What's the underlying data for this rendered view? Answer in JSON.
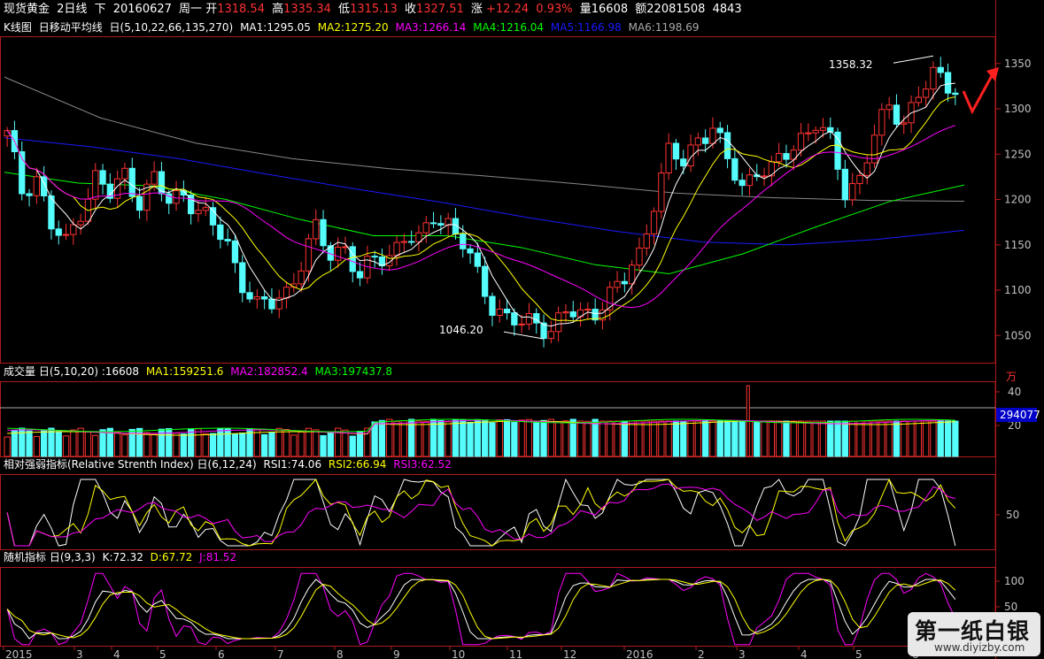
{
  "header": {
    "name": "现货黄金",
    "period": "2日线",
    "arrow": "下",
    "date": "20160627",
    "weekday": "周一",
    "open_label": "开",
    "open": "1318.54",
    "high_label": "高",
    "high": "1335.34",
    "low_label": "低",
    "low": "1315.13",
    "close_label": "收",
    "close": "1327.51",
    "chg_label": "涨",
    "chg": "+12.24",
    "chg_pct": "0.93%",
    "vol_label": "量",
    "vol": "16608",
    "amt_label": "额",
    "amt": "22081508",
    "extra": "4843"
  },
  "ma_legend": {
    "title": "K线图",
    "ind": "日移动平均线",
    "params": "日(5,10,22,66,135,270)",
    "items": [
      {
        "label": "MA1:1295.05",
        "color": "#ffffff"
      },
      {
        "label": "MA2:1275.20",
        "color": "#ffff00"
      },
      {
        "label": "MA3:1266.14",
        "color": "#ff00ff"
      },
      {
        "label": "MA4:1216.04",
        "color": "#00ff00"
      },
      {
        "label": "MA5:1166.98",
        "color": "#1a1aff"
      },
      {
        "label": "MA6:1198.69",
        "color": "#aaaaaa"
      }
    ]
  },
  "vol_legend": {
    "title": "成交量",
    "params": "日(5,10,20)",
    "value": ":16608",
    "items": [
      {
        "label": "MA1:159251.6",
        "color": "#ffff00"
      },
      {
        "label": "MA2:182852.4",
        "color": "#ff00ff"
      },
      {
        "label": "MA3:197437.8",
        "color": "#00ff00"
      }
    ],
    "unit": "万",
    "axis_ticks": [
      "40",
      "20"
    ],
    "highlight": "294077"
  },
  "rsi_legend": {
    "title": "相对强弱指标(Relative Strenth Index)",
    "params": "日(6,12,24)",
    "items": [
      {
        "label": "RSI1:74.06",
        "color": "#ffffff"
      },
      {
        "label": "RSI2:66.94",
        "color": "#ffff00"
      },
      {
        "label": "RSI3:62.52",
        "color": "#ff00ff"
      }
    ],
    "axis_ticks": [
      "50"
    ]
  },
  "kdj_legend": {
    "title": "随机指标",
    "params": "日(9,3,3)",
    "items": [
      {
        "label": "K:72.32",
        "color": "#ffffff"
      },
      {
        "label": "D:67.72",
        "color": "#ffff00"
      },
      {
        "label": "J:81.52",
        "color": "#ff00ff"
      }
    ],
    "axis_ticks": [
      "100",
      "50"
    ]
  },
  "colors": {
    "up": "#ff3232",
    "down": "#54fcfc",
    "frame": "#b01a1a",
    "text": "#c0c0c0"
  },
  "chart_data": {
    "type": "candlestick",
    "ylim": [
      1020,
      1380
    ],
    "y_ticks": [
      1050,
      1100,
      1150,
      1200,
      1250,
      1300,
      1350
    ],
    "x_ticks": [
      "2015",
      "3",
      "4",
      "5",
      "6",
      "7",
      "8",
      "9",
      "10",
      "11",
      "12",
      "2016",
      "2",
      "3",
      "4",
      "5",
      "6"
    ],
    "annotations": [
      {
        "label": "1358.32",
        "value": 1358.32,
        "kind": "high"
      },
      {
        "label": "1046.20",
        "value": 1046.2,
        "kind": "low"
      }
    ],
    "close_path": [
      1270,
      1210,
      1226,
      1170,
      1150,
      1190,
      1224,
      1204,
      1228,
      1200,
      1222,
      1195,
      1210,
      1187,
      1170,
      1150,
      1110,
      1080,
      1085,
      1100,
      1130,
      1165,
      1140,
      1150,
      1110,
      1135,
      1140,
      1160,
      1150,
      1184,
      1175,
      1150,
      1115,
      1085,
      1070,
      1060,
      1065,
      1058,
      1075,
      1070,
      1080,
      1095,
      1110,
      1140,
      1200,
      1250,
      1240,
      1270,
      1280,
      1240,
      1215,
      1235,
      1230,
      1250,
      1270,
      1285,
      1260,
      1210,
      1225,
      1270,
      1300,
      1290,
      1315,
      1335,
      1327
    ],
    "ma_series": [
      {
        "name": "MA6",
        "color": "#888888",
        "values": [
          1335,
          1290,
          1262,
          1245,
          1234,
          1226,
          1217,
          1207,
          1202,
          1199,
          1198
        ]
      },
      {
        "name": "MA5",
        "color": "#1a1aff",
        "values": [
          1268,
          1258,
          1245,
          1228,
          1212,
          1197,
          1180,
          1165,
          1153,
          1150,
          1156,
          1166
        ]
      },
      {
        "name": "MA4",
        "color": "#00ff00",
        "values": [
          1230,
          1218,
          1215,
          1200,
          1178,
          1160,
          1160,
          1147,
          1128,
          1118,
          1140,
          1170,
          1198,
          1216
        ]
      }
    ]
  },
  "watermark": {
    "main": "第一纸白银",
    "sub": "www.diyizby.com"
  }
}
